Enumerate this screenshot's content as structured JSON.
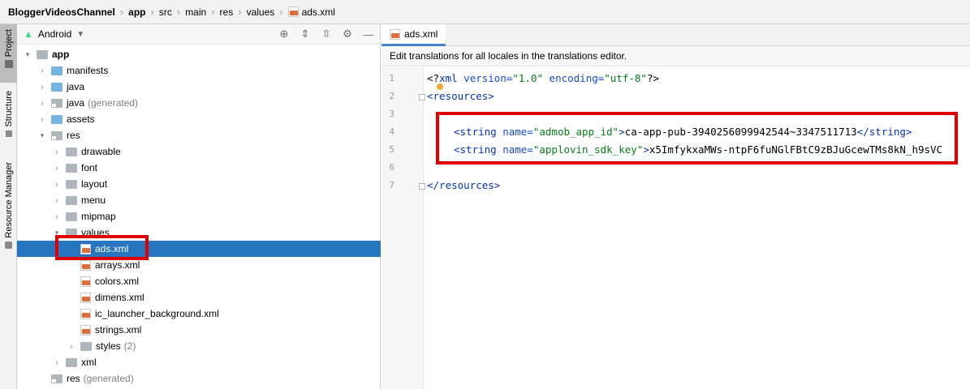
{
  "breadcrumb": {
    "items": [
      "BloggerVideosChannel",
      "app",
      "src",
      "main",
      "res",
      "values",
      "ads.xml"
    ]
  },
  "toolstrip": {
    "tabs": [
      "Project",
      "Structure",
      "Resource Manager"
    ]
  },
  "project_panel": {
    "view_mode": "Android",
    "tree": [
      {
        "label": "app",
        "suffix": "",
        "depth": 0,
        "expanded": true,
        "icon": "module-folder-icon"
      },
      {
        "label": "manifests",
        "suffix": "",
        "depth": 1,
        "expanded": false,
        "icon": "folder-icon"
      },
      {
        "label": "java",
        "suffix": "",
        "depth": 1,
        "expanded": false,
        "icon": "folder-icon"
      },
      {
        "label": "java",
        "suffix": "(generated)",
        "depth": 1,
        "expanded": false,
        "icon": "generated-folder-icon"
      },
      {
        "label": "assets",
        "suffix": "",
        "depth": 1,
        "expanded": false,
        "icon": "folder-icon"
      },
      {
        "label": "res",
        "suffix": "",
        "depth": 1,
        "expanded": true,
        "icon": "res-folder-icon"
      },
      {
        "label": "drawable",
        "suffix": "",
        "depth": 2,
        "expanded": false,
        "icon": "folder-icon"
      },
      {
        "label": "font",
        "suffix": "",
        "depth": 2,
        "expanded": false,
        "icon": "folder-icon"
      },
      {
        "label": "layout",
        "suffix": "",
        "depth": 2,
        "expanded": false,
        "icon": "folder-icon"
      },
      {
        "label": "menu",
        "suffix": "",
        "depth": 2,
        "expanded": false,
        "icon": "folder-icon"
      },
      {
        "label": "mipmap",
        "suffix": "",
        "depth": 2,
        "expanded": false,
        "icon": "folder-icon"
      },
      {
        "label": "values",
        "suffix": "",
        "depth": 2,
        "expanded": true,
        "icon": "folder-icon"
      },
      {
        "label": "ads.xml",
        "suffix": "",
        "depth": 3,
        "selected": true,
        "icon": "xml-file-icon"
      },
      {
        "label": "arrays.xml",
        "suffix": "",
        "depth": 3,
        "icon": "xml-file-icon"
      },
      {
        "label": "colors.xml",
        "suffix": "",
        "depth": 3,
        "icon": "xml-file-icon"
      },
      {
        "label": "dimens.xml",
        "suffix": "",
        "depth": 3,
        "icon": "xml-file-icon"
      },
      {
        "label": "ic_launcher_background.xml",
        "suffix": "",
        "depth": 3,
        "icon": "xml-file-icon"
      },
      {
        "label": "strings.xml",
        "suffix": "",
        "depth": 3,
        "icon": "xml-file-icon"
      },
      {
        "label": "styles",
        "suffix": "(2)",
        "depth": 3,
        "expanded": false,
        "icon": "folder-icon"
      },
      {
        "label": "xml",
        "suffix": "",
        "depth": 2,
        "expanded": false,
        "icon": "folder-icon"
      },
      {
        "label": "res",
        "suffix": "(generated)",
        "depth": 1,
        "icon": "res-folder-icon"
      }
    ]
  },
  "editor": {
    "tab_label": "ads.xml",
    "notice": "Edit translations for all locales in the translations editor.",
    "line_numbers": [
      "1",
      "2",
      "3",
      "4",
      "5",
      "6",
      "7"
    ],
    "lines": {
      "l1": {
        "open": "<?",
        "xml": "xml",
        "attr1": " version=",
        "val1": "\"1.0\"",
        "attr2": " encoding=",
        "val2": "\"utf-8\"",
        "close": "?>"
      },
      "l2": {
        "text": "<resources>"
      },
      "l4": {
        "open": "<string",
        "attr": " name=",
        "val": "\"admob_app_id\"",
        "gt": ">",
        "content": "ca-app-pub-3940256099942544~3347511713",
        "end": "</string>"
      },
      "l5": {
        "open": "<string",
        "attr": " name=",
        "val": "\"applovin_sdk_key\"",
        "gt": ">",
        "content": "x5ImfykxaMWs-ntpF6fuNGlFBtC9zBJuGcewTMs8kN_h9sVC"
      },
      "l7": {
        "text": "</resources>"
      }
    }
  },
  "colors": {
    "selection": "#2675bf",
    "highlight_box": "#e00000",
    "xml_tag": "#0033b3",
    "xml_value": "#067d17"
  }
}
